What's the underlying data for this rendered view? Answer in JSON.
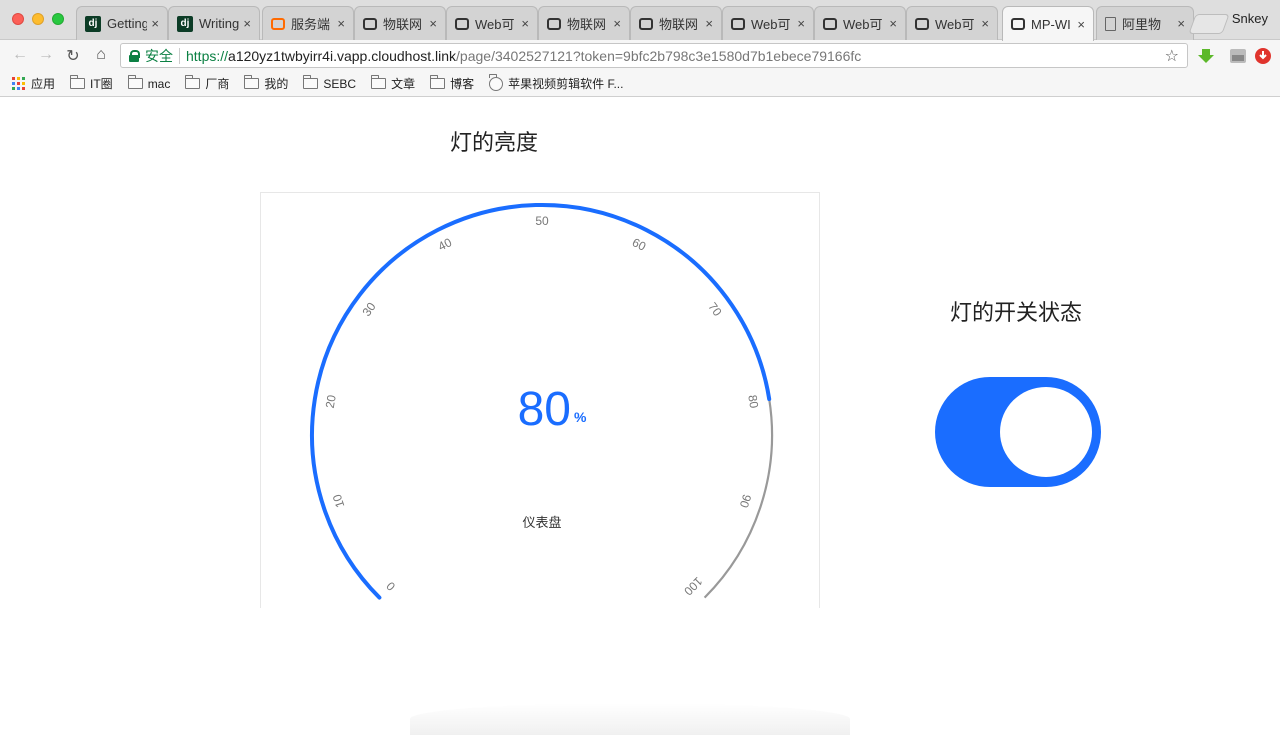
{
  "browser": {
    "profile_name": "Snkey",
    "tabs": [
      {
        "label": "Getting",
        "icon": "django-icon"
      },
      {
        "label": "Writing",
        "icon": "django-icon"
      },
      {
        "label": "服务端",
        "icon": "aliyun-icon"
      },
      {
        "label": "物联网",
        "icon": "aliyun-icon"
      },
      {
        "label": "Web可",
        "icon": "aliyun-icon"
      },
      {
        "label": "物联网",
        "icon": "aliyun-icon"
      },
      {
        "label": "物联网",
        "icon": "aliyun-icon"
      },
      {
        "label": "Web可",
        "icon": "aliyun-icon"
      },
      {
        "label": "Web可",
        "icon": "aliyun-icon"
      },
      {
        "label": "Web可",
        "icon": "aliyun-icon"
      },
      {
        "label": "MP-WI",
        "icon": "aliyun-icon",
        "active": true
      },
      {
        "label": "阿里物",
        "icon": "document-icon"
      }
    ],
    "close_glyph": "×",
    "secure_label": "安全",
    "url_scheme": "https://",
    "url_host": "a120yz1twbyirr4i.vapp.cloudhost.link",
    "url_path": "/page/3402527121?token=9bfc2b798c3e1580d7b1ebece79166fc",
    "bookmarks": [
      {
        "label": "应用",
        "type": "apps"
      },
      {
        "label": "IT圈",
        "type": "folder"
      },
      {
        "label": "mac",
        "type": "folder"
      },
      {
        "label": "厂商",
        "type": "folder"
      },
      {
        "label": "我的",
        "type": "folder"
      },
      {
        "label": "SEBC",
        "type": "folder"
      },
      {
        "label": "文章",
        "type": "folder"
      },
      {
        "label": "博客",
        "type": "folder"
      },
      {
        "label": "苹果视频剪辑软件 F...",
        "type": "page"
      }
    ]
  },
  "page": {
    "gauge_title": "灯的亮度",
    "switch_title": "灯的开关状态",
    "switch_on": true,
    "colors": {
      "accent": "#1a6dff",
      "track": "#999999"
    }
  },
  "chart_data": {
    "type": "gauge",
    "title": "仪表盘",
    "value": 80,
    "unit": "%",
    "min": 0,
    "max": 100,
    "ticks": [
      "0",
      "10",
      "20",
      "30",
      "40",
      "50",
      "60",
      "70",
      "80",
      "90",
      "100"
    ]
  }
}
